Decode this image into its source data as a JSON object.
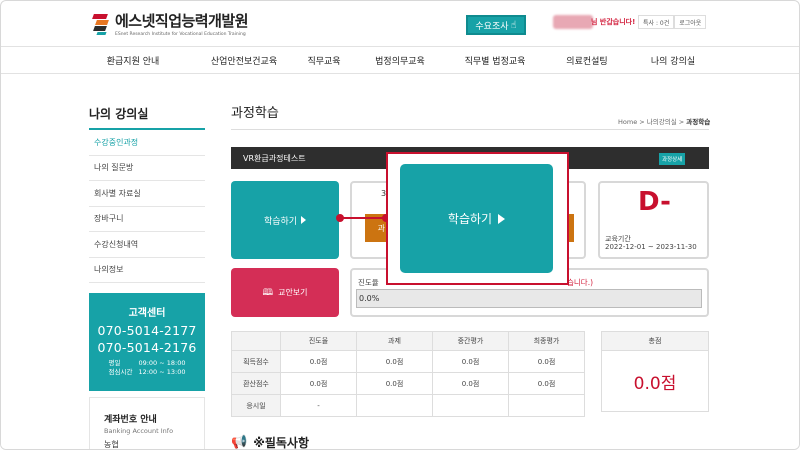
{
  "header": {
    "logo_main": "에스넷직업능력개발원",
    "logo_sub": "ESnet Research Institute for Vocational Education Training",
    "survey_label": "수요조사",
    "welcome": "님 반갑습니다!",
    "links": [
      "특사 : 0건",
      "로그아웃"
    ]
  },
  "nav": {
    "items": [
      "환급지원 안내",
      "산업안전보건교육",
      "직무교육",
      "법정의무교육",
      "직무별 법정교육",
      "의료컨설팅",
      "나의 강의실"
    ]
  },
  "sidebar": {
    "title": "나의 강의실",
    "items": [
      "수강중인과정",
      "나의 질문방",
      "회사별 자료실",
      "장바구니",
      "수강신청내역",
      "나의정보"
    ],
    "cs": {
      "title": "고객센터",
      "phone1": "070-5014-2177",
      "phone2": "070-5014-2176",
      "hours_labels": [
        "평일",
        "점심시간"
      ],
      "hours_values": [
        "09:00 ~ 18:00",
        "12:00 ~ 13:00"
      ]
    },
    "account": {
      "title": "계좌번호 안내",
      "sub": "Banking Account Info",
      "bank": "농협"
    }
  },
  "main": {
    "page_title": "과정학습",
    "breadcrumb_prefix": "Home > 나의강의실 > ",
    "breadcrumb_current": "과정학습",
    "course_name": "VR환급과정테스트",
    "course_detail": "과정상세",
    "study_label": "학습하기",
    "dday": "D-",
    "period_label": "교육기간",
    "period_value": "2022-12-01 ~ 2023-11-30",
    "textbook_label": "교안보기",
    "progress_label": "진도율",
    "progress_warn": "습니다.)",
    "progress_value": "0.0%",
    "mid_partial_1": "과",
    "mid_partial_2": "3"
  },
  "popup": {
    "label": "학습하기"
  },
  "scores": {
    "columns": [
      "진도율",
      "과제",
      "중간평가",
      "최종평가"
    ],
    "rows": [
      {
        "label": "획득점수",
        "values": [
          "0.0점",
          "0.0점",
          "0.0점",
          "0.0점"
        ]
      },
      {
        "label": "환산점수",
        "values": [
          "0.0점",
          "0.0점",
          "0.0점",
          "0.0점"
        ]
      },
      {
        "label": "응시일",
        "values": [
          "-",
          "",
          "",
          ""
        ]
      }
    ],
    "total_label": "총점",
    "total_value": "0.0점"
  },
  "notice": {
    "title": "※필독사항"
  },
  "colors": {
    "accent": "#17a2a7",
    "highlight": "#c8102e",
    "textbook": "#d42e56",
    "orange": "#cc7411"
  }
}
